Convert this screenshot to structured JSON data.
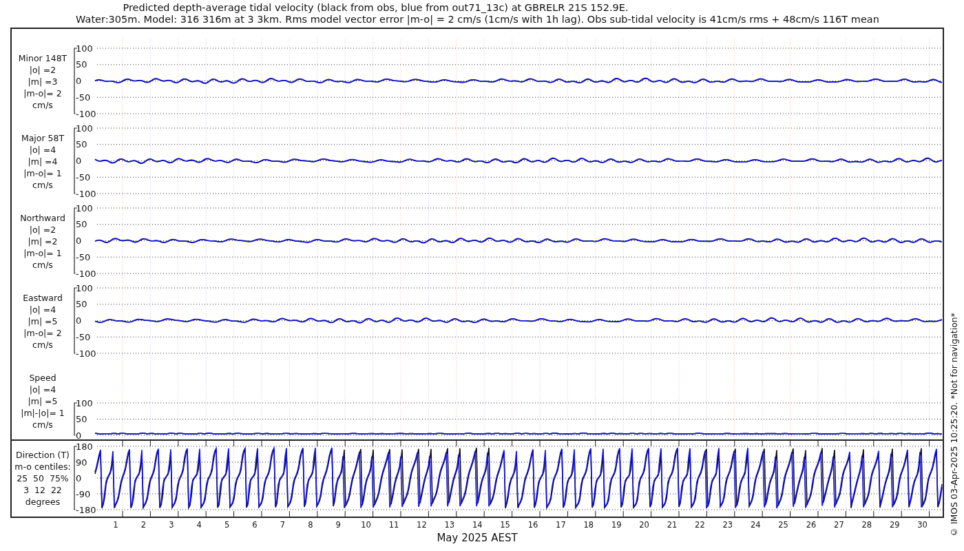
{
  "title": {
    "line_1": "Predicted depth-average tidal velocity (black from obs, blue from out71_13c) at GBRELR 21S 152.9E.",
    "line_2": "Water:305m. Model: 316 316m at 3 3km. Rms model vector error |m-o| = 2 cm/s (1cm/s with 1h lag). Obs sub-tidal velocity is 41cm/s rms + 48cm/s 116T mean"
  },
  "panels": [
    {
      "kind": "component",
      "label_lines": [
        "Minor 148T",
        "|o| =2",
        "|m| =3",
        "|m-o|= 2",
        "cm/s"
      ],
      "yticks": [
        "100",
        "50",
        "0",
        "-50",
        "-100"
      ]
    },
    {
      "kind": "component",
      "label_lines": [
        "Major 58T",
        "|o| =4",
        "|m| =4",
        "|m-o|= 1",
        "cm/s"
      ],
      "yticks": [
        "100",
        "50",
        "0",
        "-50",
        "-100"
      ]
    },
    {
      "kind": "component",
      "label_lines": [
        "Northward",
        "|o| =2",
        "|m| =2",
        "|m-o|= 1",
        "cm/s"
      ],
      "yticks": [
        "100",
        "50",
        "0",
        "-50",
        "-100"
      ]
    },
    {
      "kind": "component",
      "label_lines": [
        "Eastward",
        "|o| =4",
        "|m| =5",
        "|m-o|= 2",
        "cm/s"
      ],
      "yticks": [
        "100",
        "50",
        "0",
        "-50",
        "-100"
      ]
    },
    {
      "kind": "speed",
      "label_lines": [
        "Speed",
        "|o| =4",
        "|m| =5",
        "|m|-|o|= 1",
        "cm/s"
      ],
      "yticks": [
        "100",
        "50",
        "0"
      ]
    },
    {
      "kind": "direction",
      "label_lines": [
        "Direction (T)",
        "m-o centiles:",
        "25  50  75%",
        "3  12  22",
        "degrees"
      ],
      "yticks": [
        "180",
        "90",
        "0",
        "-90",
        "-180"
      ]
    }
  ],
  "x_axis": {
    "day_labels": [
      "1",
      "2",
      "3",
      "4",
      "5",
      "6",
      "7",
      "8",
      "9",
      "10",
      "11",
      "12",
      "13",
      "14",
      "15",
      "16",
      "17",
      "18",
      "19",
      "20",
      "21",
      "22",
      "23",
      "24",
      "25",
      "26",
      "27",
      "28",
      "29",
      "30"
    ],
    "label": "May 2025 AEST"
  },
  "side_note": "© IMOS 03-Apr-2025 10:25:20. *Not for navigation*"
}
